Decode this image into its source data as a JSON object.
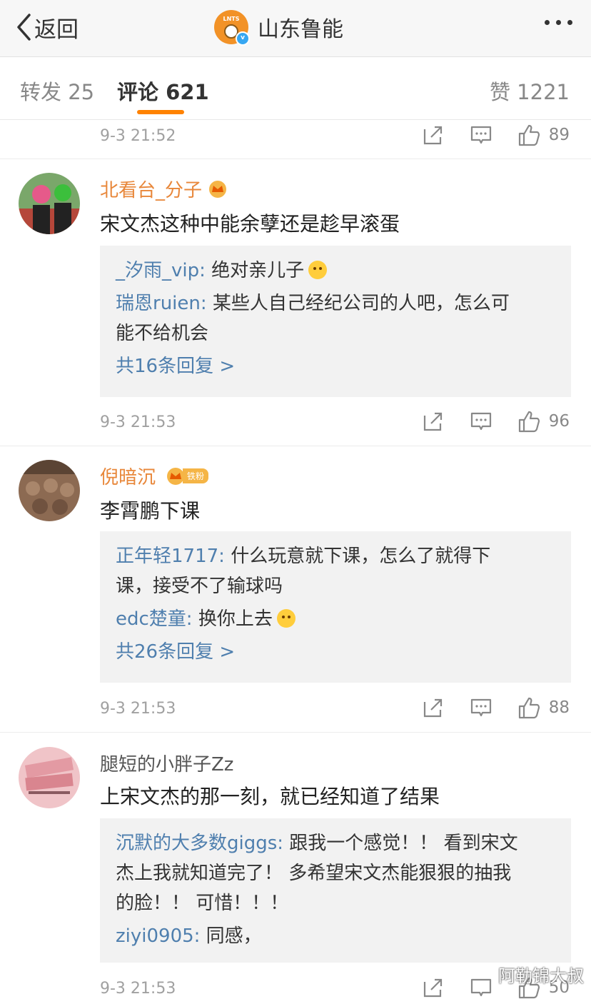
{
  "nav": {
    "back_label": "返回",
    "account_name": "山东鲁能",
    "logo_text": "LNTS"
  },
  "tabs": [
    {
      "label": "转发 25"
    },
    {
      "label": "评论 621"
    },
    {
      "label": "赞 1221"
    }
  ],
  "top_actions": {
    "time": "9-3 21:52",
    "likes": "89"
  },
  "comments": [
    {
      "user": "北看台_分子",
      "text": "宋文杰这种中能余孽还是趁早滚蛋",
      "replies": [
        {
          "user": "_汐雨_vip:",
          "text": " 绝对亲儿子"
        },
        {
          "user": "瑞恩ruien:",
          "text": " 某些人自己经纪公司的人吧，怎么可",
          "text2": "能不给机会"
        }
      ],
      "more_replies": "共16条回复 >",
      "time": "9-3 21:53",
      "likes": "96"
    },
    {
      "user": "倪暗沉",
      "badge": "铁粉",
      "text": "李霄鹏下课",
      "replies": [
        {
          "user": "正年轻1717:",
          "text": " 什么玩意就下课，怎么了就得下",
          "text2": "课，接受不了输球吗"
        },
        {
          "user": "edc楚童:",
          "text": " 换你上去"
        }
      ],
      "more_replies": "共26条回复 >",
      "time": "9-3 21:53",
      "likes": "88"
    },
    {
      "user": "腿短的小胖子Zz",
      "text": "上宋文杰的那一刻，就已经知道了结果",
      "replies": [
        {
          "user": "沉默的大多数giggs:",
          "text": " 跟我一个感觉！！ 看到宋文",
          "text2": "杰上我就知道完了！ 多希望宋文杰能狠狠的抽我",
          "text3": "的脸！！ 可惜！！！"
        },
        {
          "user": "ziyi0905:",
          "text": " 同感，"
        }
      ],
      "time": "9-3 21:53",
      "likes": "50"
    }
  ],
  "watermark": "阿勒锦大叔",
  "colors": {
    "accent": "#ff8200",
    "link": "#4f7fae",
    "vip_name": "#e8873a"
  }
}
